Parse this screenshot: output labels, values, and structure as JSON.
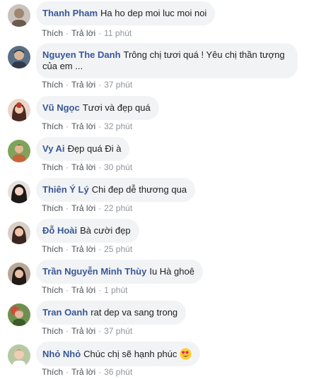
{
  "labels": {
    "like": "Thích",
    "reply": "Trả lời",
    "sep": "·"
  },
  "comments": [
    {
      "author": "Thanh Pham",
      "text": "Ha ho dep moi luc moi noi",
      "time": "11 phút"
    },
    {
      "author": "Nguyen The Danh",
      "text": "Trông chị tươi quá ! Yêu chị thần tượng của em ...",
      "time": "37 phút"
    },
    {
      "author": "Vũ Ngọc",
      "text": "Tươi và đẹp quá",
      "time": "32 phút"
    },
    {
      "author": "Vy Ai",
      "text": "Đẹp quá Đi à",
      "time": "30 phút"
    },
    {
      "author": "Thiên Ý Lý",
      "text": "Chi đep dễ thương qua",
      "time": "22 phút"
    },
    {
      "author": "Đỗ Hoài",
      "text": "Bà cười đẹp",
      "time": "25 phút"
    },
    {
      "author": "Trần Nguyễn Minh Thùy",
      "text": "Iu Hà ghoê",
      "time": "1 phút"
    },
    {
      "author": "Tran Oanh",
      "text": "rat dep va sang trong",
      "time": "37 phút"
    },
    {
      "author": "Nhỏ Nhỏ",
      "text": "Chúc chị sẽ hạnh phúc",
      "time": "36 phút",
      "emoji": "smiling-face-with-heart-eyes-icon"
    }
  ],
  "colors": {
    "author": "#385898",
    "bubble": "#f2f3f5",
    "meta": "#90949c"
  }
}
